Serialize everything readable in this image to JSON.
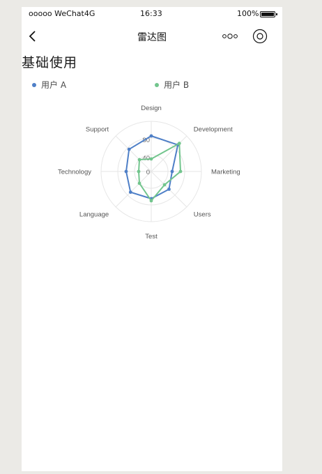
{
  "status_bar": {
    "carrier": "ooooo WeChat4G",
    "time": "16:33",
    "battery_pct": "100%"
  },
  "nav": {
    "title": "雷达图",
    "back_icon": "chevron-left-icon",
    "more_icon": "more-dots-icon",
    "close_icon": "target-close-icon"
  },
  "section": {
    "title": "基础使用"
  },
  "legend": [
    {
      "label": "用户 A",
      "color": "#4e7fc7"
    },
    {
      "label": "用户 B",
      "color": "#72c58d"
    }
  ],
  "chart_data": {
    "type": "radar",
    "indicators": [
      "Design",
      "Development",
      "Marketing",
      "Users",
      "Test",
      "Language",
      "Technology",
      "Support"
    ],
    "ticks": [
      "0",
      "40",
      "80"
    ],
    "max": 120,
    "series": [
      {
        "name": "用户 A",
        "color": "#4e7fc7",
        "values": [
          85,
          90,
          50,
          60,
          65,
          70,
          60,
          75
        ]
      },
      {
        "name": "用户 B",
        "color": "#72c58d",
        "values": [
          30,
          95,
          70,
          45,
          70,
          40,
          30,
          40
        ]
      }
    ]
  }
}
